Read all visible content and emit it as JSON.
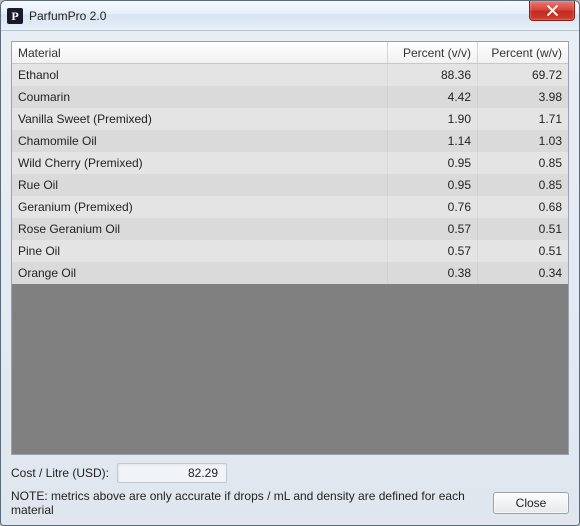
{
  "window": {
    "title": "ParfumPro 2.0"
  },
  "table": {
    "headers": {
      "material": "Material",
      "vv": "Percent (v/v)",
      "wv": "Percent (w/v)"
    },
    "rows": [
      {
        "material": "Ethanol",
        "vv": "88.36",
        "wv": "69.72"
      },
      {
        "material": "Coumarin",
        "vv": "4.42",
        "wv": "3.98"
      },
      {
        "material": "Vanilla Sweet (Premixed)",
        "vv": "1.90",
        "wv": "1.71"
      },
      {
        "material": "Chamomile Oil",
        "vv": "1.14",
        "wv": "1.03"
      },
      {
        "material": "Wild Cherry (Premixed)",
        "vv": "0.95",
        "wv": "0.85"
      },
      {
        "material": "Rue Oil",
        "vv": "0.95",
        "wv": "0.85"
      },
      {
        "material": "Geranium (Premixed)",
        "vv": "0.76",
        "wv": "0.68"
      },
      {
        "material": "Rose Geranium Oil",
        "vv": "0.57",
        "wv": "0.51"
      },
      {
        "material": "Pine Oil",
        "vv": "0.57",
        "wv": "0.51"
      },
      {
        "material": "Orange Oil",
        "vv": "0.38",
        "wv": "0.34"
      }
    ]
  },
  "footer": {
    "cost_label": "Cost / Litre (USD):",
    "cost_value": "82.29",
    "note": "NOTE: metrics above are only accurate if drops / mL and density are defined for each material",
    "close_label": "Close"
  }
}
